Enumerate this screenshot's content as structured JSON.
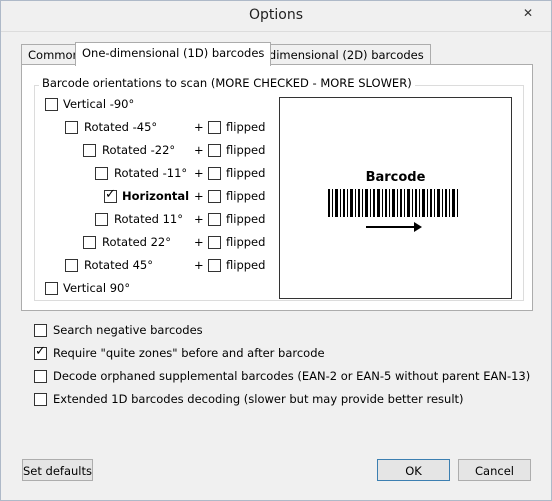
{
  "window": {
    "title": "Options"
  },
  "tabs": [
    "Common",
    "One-dimensional (1D) barcodes",
    "Two-dimensional (2D) barcodes"
  ],
  "group_title": "Barcode orientations to scan (MORE CHECKED - MORE SLOWER)",
  "orientations": [
    {
      "label": "Vertical -90°",
      "checked": false,
      "has_flipped": false
    },
    {
      "label": "Rotated -45°",
      "checked": false,
      "has_flipped": true,
      "flipped_checked": false
    },
    {
      "label": "Rotated -22°",
      "checked": false,
      "has_flipped": true,
      "flipped_checked": false
    },
    {
      "label": "Rotated -11°",
      "checked": false,
      "has_flipped": true,
      "flipped_checked": false
    },
    {
      "label": "Horizontal",
      "checked": true,
      "bold": true,
      "has_flipped": true,
      "flipped_checked": false
    },
    {
      "label": "Rotated 11°",
      "checked": false,
      "has_flipped": true,
      "flipped_checked": false
    },
    {
      "label": "Rotated 22°",
      "checked": false,
      "has_flipped": true,
      "flipped_checked": false
    },
    {
      "label": "Rotated 45°",
      "checked": false,
      "has_flipped": true,
      "flipped_checked": false
    },
    {
      "label": "Vertical 90°",
      "checked": false,
      "has_flipped": false
    }
  ],
  "plus_text": "+",
  "flipped_text": "flipped",
  "preview": {
    "title": "Barcode"
  },
  "options": [
    {
      "label": "Search negative barcodes",
      "checked": false
    },
    {
      "label": "Require \"quite zones\" before and after barcode",
      "checked": true
    },
    {
      "label": "Decode orphaned supplemental barcodes (EAN-2 or EAN-5 without parent EAN-13)",
      "checked": false
    },
    {
      "label": "Extended 1D barcodes decoding (slower but may provide better result)",
      "checked": false
    }
  ],
  "buttons": {
    "set_defaults": "Set defaults",
    "ok": "OK",
    "cancel": "Cancel"
  }
}
